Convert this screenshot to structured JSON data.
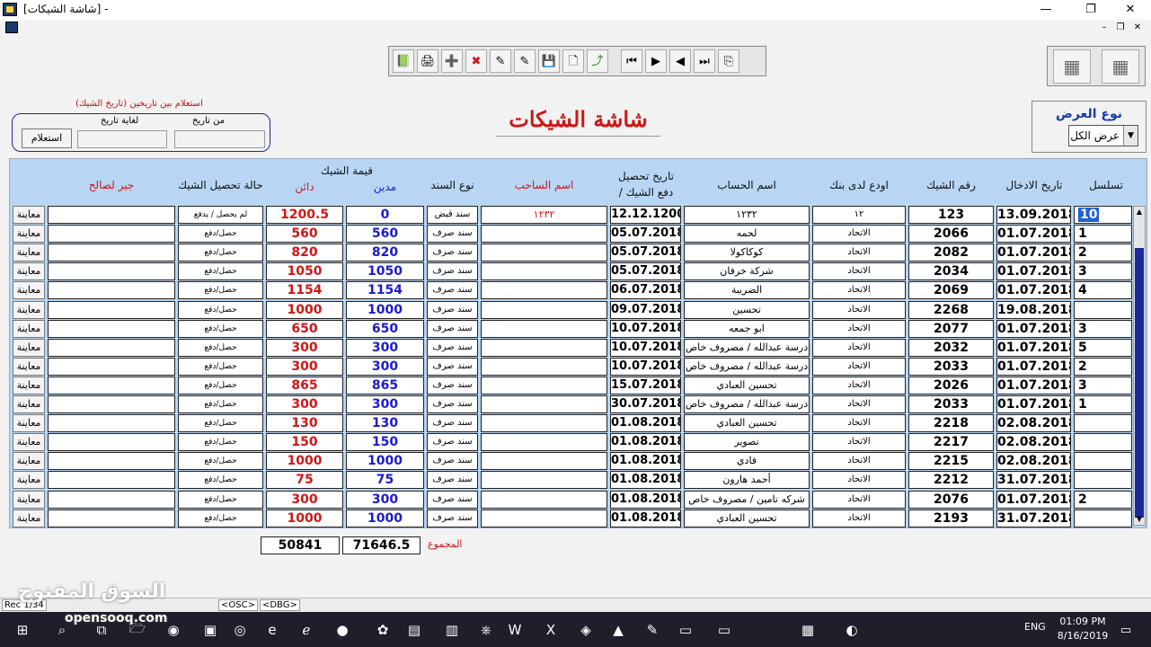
{
  "window": {
    "title": "[شاشة الشيكات] -",
    "minimize": "—",
    "maximize": "❐",
    "close": "✕",
    "mdi_min": "–",
    "mdi_restore": "❐",
    "mdi_close": "✕"
  },
  "toolbar": {
    "icons": [
      "📗",
      "🖨",
      "➕",
      "✖",
      "✎",
      "✎",
      "💾",
      "🗋",
      "⤴",
      "⏮",
      "▶",
      "◀",
      "⏭",
      "⎘"
    ]
  },
  "corner_icons": [
    "▦",
    "▦"
  ],
  "view_type": {
    "label": "نوع العرض",
    "selected": "عرض الكل",
    "arrow": "▼"
  },
  "page_title": "شاشة الشيكات",
  "query": {
    "caption": "استعلام بين تاريخين (تاريخ الشيك)",
    "from_label": "من تاريخ",
    "to_label": "لغاية تاريخ",
    "from_value": "",
    "to_value": "",
    "button": "استعلام"
  },
  "columns": {
    "serial": "تسلسل",
    "entry_date": "تاريخ الادخال",
    "cheque_no": "رقم الشيك",
    "bank": "اودع لدى بنك",
    "account": "اسم الحساب",
    "collect_date_1": "تاريخ تحصيل",
    "collect_date_2": "/ دفع الشيك",
    "drawer": "اسم الساحب",
    "doc_type": "نوع السند",
    "value_group": "قيمة الشيك",
    "debit": "مدين",
    "credit": "دائن",
    "status": "حالة تحصيل الشيك",
    "payee": "جير لصالح"
  },
  "rows": [
    {
      "serial": "10",
      "entry_date": "13.09.2018",
      "cheque_no": "123",
      "bank": "١٢",
      "account": "١٢٣٢",
      "collect_date": "12.12.1200",
      "drawer": "١٢٣٢",
      "doc_type": "سند قبض",
      "debit": "0",
      "credit": "1200.5",
      "status": "لم يحصل / يدفع",
      "payee": "",
      "preview": "معاينة"
    },
    {
      "serial": "1",
      "entry_date": "01.07.2018",
      "cheque_no": "2066",
      "bank": "الاتحاد",
      "account": "لحمه",
      "collect_date": "05.07.2018",
      "drawer": "",
      "doc_type": "سند صرف",
      "debit": "560",
      "credit": "560",
      "status": "حصل/دفع",
      "payee": "",
      "preview": "معاينة"
    },
    {
      "serial": "2",
      "entry_date": "01.07.2018",
      "cheque_no": "2082",
      "bank": "الاتحاد",
      "account": "كوكاكولا",
      "collect_date": "05.07.2018",
      "drawer": "",
      "doc_type": "سند صرف",
      "debit": "820",
      "credit": "820",
      "status": "حصل/دفع",
      "payee": "",
      "preview": "معاينة"
    },
    {
      "serial": "3",
      "entry_date": "01.07.2018",
      "cheque_no": "2034",
      "bank": "الاتحاد",
      "account": "شركة خرفان",
      "collect_date": "05.07.2018",
      "drawer": "",
      "doc_type": "سند صرف",
      "debit": "1050",
      "credit": "1050",
      "status": "حصل/دفع",
      "payee": "",
      "preview": "معاينة"
    },
    {
      "serial": "4",
      "entry_date": "01.07.2018",
      "cheque_no": "2069",
      "bank": "الاتحاد",
      "account": "الضريبة",
      "collect_date": "06.07.2018",
      "drawer": "",
      "doc_type": "سند صرف",
      "debit": "1154",
      "credit": "1154",
      "status": "حصل/دفع",
      "payee": "",
      "preview": "معاينة"
    },
    {
      "serial": "",
      "entry_date": "19.08.2018",
      "cheque_no": "2268",
      "bank": "الاتحاد",
      "account": "تحسين",
      "collect_date": "09.07.2018",
      "drawer": "",
      "doc_type": "سند صرف",
      "debit": "1000",
      "credit": "1000",
      "status": "حصل/دفع",
      "payee": "",
      "preview": "معاينة"
    },
    {
      "serial": "3",
      "entry_date": "01.07.2018",
      "cheque_no": "2077",
      "bank": "الاتحاد",
      "account": "ابو جمعه",
      "collect_date": "10.07.2018",
      "drawer": "",
      "doc_type": "سند صرف",
      "debit": "650",
      "credit": "650",
      "status": "حصل/دفع",
      "payee": "",
      "preview": "معاينة"
    },
    {
      "serial": "5",
      "entry_date": "01.07.2018",
      "cheque_no": "2032",
      "bank": "الاتحاد",
      "account": "درسة عبدالله / مصروف خاص",
      "collect_date": "10.07.2018",
      "drawer": "",
      "doc_type": "سند صرف",
      "debit": "300",
      "credit": "300",
      "status": "حصل/دفع",
      "payee": "",
      "preview": "معاينة"
    },
    {
      "serial": "2",
      "entry_date": "01.07.2018",
      "cheque_no": "2033",
      "bank": "الاتحاد",
      "account": "درسة عبدالله / مصروف خاص",
      "collect_date": "10.07.2018",
      "drawer": "",
      "doc_type": "سند صرف",
      "debit": "300",
      "credit": "300",
      "status": "حصل/دفع",
      "payee": "",
      "preview": "معاينة"
    },
    {
      "serial": "3",
      "entry_date": "01.07.2018",
      "cheque_no": "2026",
      "bank": "الاتحاد",
      "account": "تحسين العبادي",
      "collect_date": "15.07.2018",
      "drawer": "",
      "doc_type": "سند صرف",
      "debit": "865",
      "credit": "865",
      "status": "حصل/دفع",
      "payee": "",
      "preview": "معاينة"
    },
    {
      "serial": "1",
      "entry_date": "01.07.2018",
      "cheque_no": "2033",
      "bank": "الاتحاد",
      "account": "درسة عبدالله / مصروف خاص",
      "collect_date": "30.07.2018",
      "drawer": "",
      "doc_type": "سند صرف",
      "debit": "300",
      "credit": "300",
      "status": "حصل/دفع",
      "payee": "",
      "preview": "معاينة"
    },
    {
      "serial": "",
      "entry_date": "02.08.2018",
      "cheque_no": "2218",
      "bank": "الاتحاد",
      "account": "تحسين العبادي",
      "collect_date": "01.08.2018",
      "drawer": "",
      "doc_type": "سند صرف",
      "debit": "130",
      "credit": "130",
      "status": "حصل/دفع",
      "payee": "",
      "preview": "معاينة"
    },
    {
      "serial": "",
      "entry_date": "02.08.2018",
      "cheque_no": "2217",
      "bank": "الاتحاد",
      "account": "تصوير",
      "collect_date": "01.08.2018",
      "drawer": "",
      "doc_type": "سند صرف",
      "debit": "150",
      "credit": "150",
      "status": "حصل/دفع",
      "payee": "",
      "preview": "معاينة"
    },
    {
      "serial": "",
      "entry_date": "02.08.2018",
      "cheque_no": "2215",
      "bank": "الاتحاد",
      "account": "فادي",
      "collect_date": "01.08.2018",
      "drawer": "",
      "doc_type": "سند صرف",
      "debit": "1000",
      "credit": "1000",
      "status": "حصل/دفع",
      "payee": "",
      "preview": "معاينة"
    },
    {
      "serial": "",
      "entry_date": "31.07.2018",
      "cheque_no": "2212",
      "bank": "الاتحاد",
      "account": "أحمد هارون",
      "collect_date": "01.08.2018",
      "drawer": "",
      "doc_type": "سند صرف",
      "debit": "75",
      "credit": "75",
      "status": "حصل/دفع",
      "payee": "",
      "preview": "معاينة"
    },
    {
      "serial": "2",
      "entry_date": "01.07.2018",
      "cheque_no": "2076",
      "bank": "الاتحاد",
      "account": "شركه تامين / مصروف خاص",
      "collect_date": "01.08.2018",
      "drawer": "",
      "doc_type": "سند صرف",
      "debit": "300",
      "credit": "300",
      "status": "حصل/دفع",
      "payee": "",
      "preview": "معاينة"
    },
    {
      "serial": "",
      "entry_date": "31.07.2018",
      "cheque_no": "2193",
      "bank": "الاتحاد",
      "account": "تحسين العبادي",
      "collect_date": "01.08.2018",
      "drawer": "",
      "doc_type": "سند صرف",
      "debit": "1000",
      "credit": "1000",
      "status": "حصل/دفع",
      "payee": "",
      "preview": "معاينة"
    }
  ],
  "totals": {
    "label": "المجموع",
    "debit": "71646.5",
    "credit": "50841"
  },
  "scroll": {
    "up": "▲",
    "down": "▼"
  },
  "statusbar": {
    "record": "Rec 1/34",
    "osc": "<OSC>",
    "dbg": "<DBG>"
  },
  "watermark": {
    "text": "السوق المفتوح",
    "sub": "opensooq.com"
  },
  "taskbar": {
    "apps": [
      "⊞",
      "⌕",
      "⧉",
      "🗁",
      "◉",
      "▣",
      "◎",
      "e",
      "ℯ",
      "●",
      "✿",
      "▤",
      "▥",
      "⎈",
      "W",
      "X",
      "◈",
      "▲",
      "✎",
      "▭",
      "▭",
      "▦",
      "◐"
    ],
    "tray_lang": "ENG",
    "time": "01:09 PM",
    "date": "8/16/2019"
  }
}
